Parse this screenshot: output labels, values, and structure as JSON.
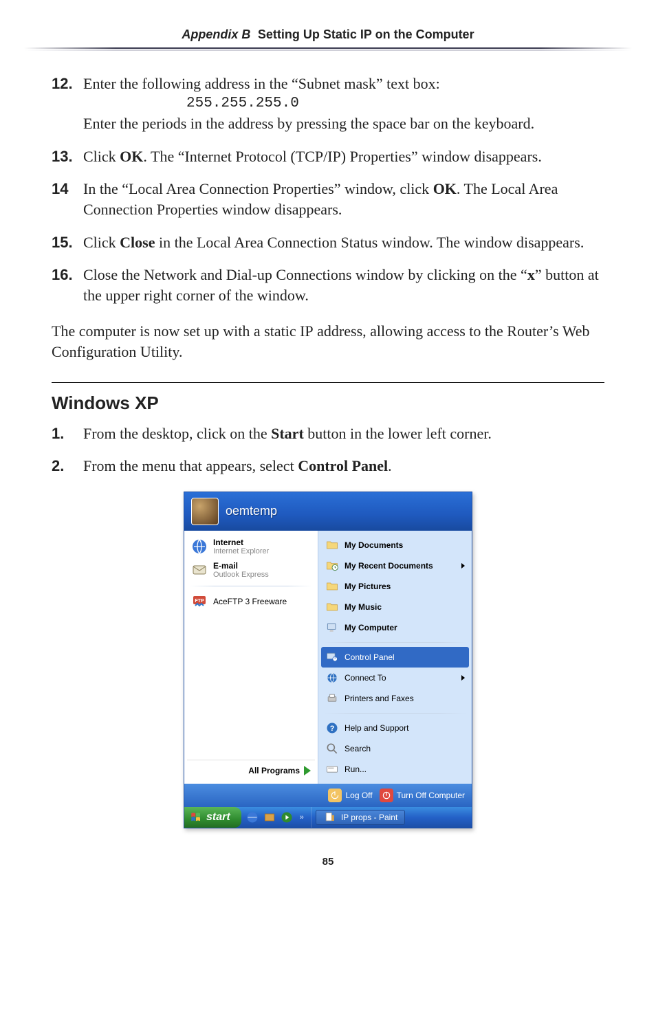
{
  "header": {
    "appendix": "Appendix B",
    "title": "Setting Up Static IP on the Computer"
  },
  "stepsA": [
    {
      "num": "12.",
      "parts": [
        {
          "t": "Enter the following address in the “Subnet mask” text box:"
        },
        {
          "code": "255.255.255.0"
        },
        {
          "t": "Enter the periods in the address by pressing the space bar on the keyboard."
        }
      ]
    },
    {
      "num": "13.",
      "html": "Click <b>OK</b>. The “Internet Protocol (<span class='sc'>TCP/IP</span>) Properties” window disappears."
    },
    {
      "num": "14",
      "html": "In the “Local Area Connection Properties” window, click <b>OK</b>. The Local Area Connection Properties window disappears."
    },
    {
      "num": "15.",
      "html": "Click <b>Close</b> in the Local Area Connection Status window. The window disappears."
    },
    {
      "num": "16.",
      "html": "Close the Network and Dial-up Connections window by clicking on the “<b>x</b>” button at the upper right corner of the window."
    }
  ],
  "flow": "The computer is now set up with a static IP address, allowing access to the Router’s Web Configuration Utility.",
  "sectionTitle": "Windows XP",
  "stepsB": [
    {
      "num": "1.",
      "html": "From the desktop, click on the <b>Start</b> button in the lower left corner."
    },
    {
      "num": "2.",
      "html": "From the menu that appears, select <b>Control Panel</b>."
    }
  ],
  "startmenu": {
    "username": "oemtemp",
    "left": {
      "internet": {
        "title": "Internet",
        "sub": "Internet Explorer"
      },
      "email": {
        "title": "E-mail",
        "sub": "Outlook Express"
      },
      "app": {
        "title": "AceFTP 3 Freeware"
      },
      "allprograms": "All Programs"
    },
    "right": {
      "mydocs": "My Documents",
      "recent": "My Recent Documents",
      "mypics": "My Pictures",
      "mymusic": "My Music",
      "mycomp": "My Computer",
      "cpanel": "Control Panel",
      "connect": "Connect To",
      "printers": "Printers and Faxes",
      "help": "Help and Support",
      "search": "Search",
      "run": "Run..."
    },
    "footer": {
      "logoff": "Log Off",
      "turnoff": "Turn Off Computer"
    }
  },
  "taskbar": {
    "start": "start",
    "task": "IP props - Paint"
  },
  "pageNumber": "85"
}
